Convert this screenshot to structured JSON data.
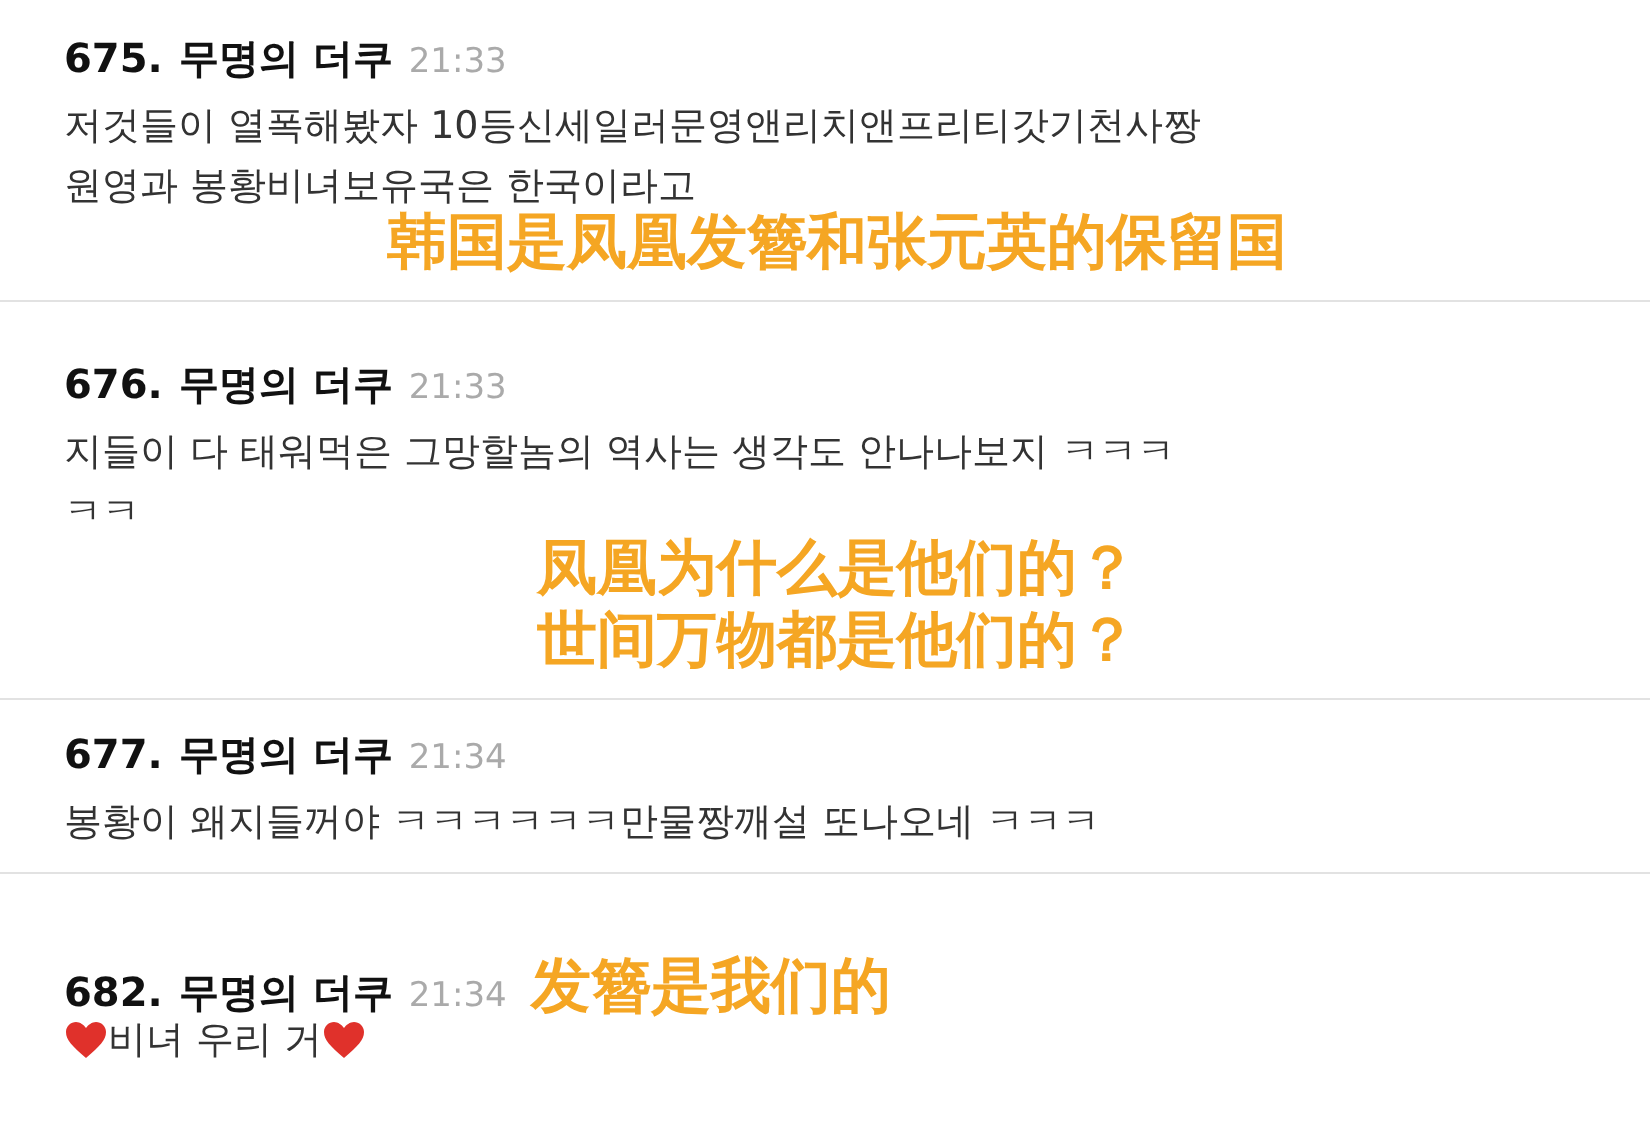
{
  "comments": [
    {
      "number": "675.",
      "author": "무명의 더쿠",
      "time": "21:33",
      "lines": [
        [
          {
            "kind": "text",
            "text": "저것들이 열폭해봤자 10등신세일러문영앤리치앤프리티갓기천사짱"
          }
        ],
        [
          {
            "kind": "text",
            "text": "원영과 봉황비녀보유국은 한국이라고"
          }
        ]
      ],
      "captions": [
        {
          "text": "韩国是凤凰发簪和张元英的保留国",
          "kind": "below"
        }
      ]
    },
    {
      "number": "676.",
      "author": "무명의 더쿠",
      "time": "21:33",
      "lines": [
        [
          {
            "kind": "text",
            "text": "지들이 다 태워먹은 그망할놈의 역사는 생각도 안나나보지 ㅋㅋㅋ"
          }
        ],
        [
          {
            "kind": "text",
            "text": "ㅋㅋ"
          }
        ]
      ],
      "captions": [
        {
          "text": "凤凰为什么是他们的？",
          "kind": "below"
        },
        {
          "text": "世间万物都是他们的？",
          "kind": "below"
        }
      ]
    },
    {
      "number": "677.",
      "author": "무명의 더쿠",
      "time": "21:34",
      "lines": [
        [
          {
            "kind": "text",
            "text": "봉황이 왜지들꺼야 ㅋㅋㅋㅋㅋㅋ만물짱깨설 또나오네 ㅋㅋㅋ"
          }
        ]
      ]
    },
    {
      "number": "682.",
      "author": "무명의 더쿠",
      "time": "21:34",
      "lines": [
        [
          {
            "kind": "heart"
          },
          {
            "kind": "text",
            "text": "비녀 우리 거"
          },
          {
            "kind": "heart"
          }
        ]
      ],
      "captions": [
        {
          "text": "发簪是我们的",
          "kind": "inline"
        }
      ]
    }
  ]
}
